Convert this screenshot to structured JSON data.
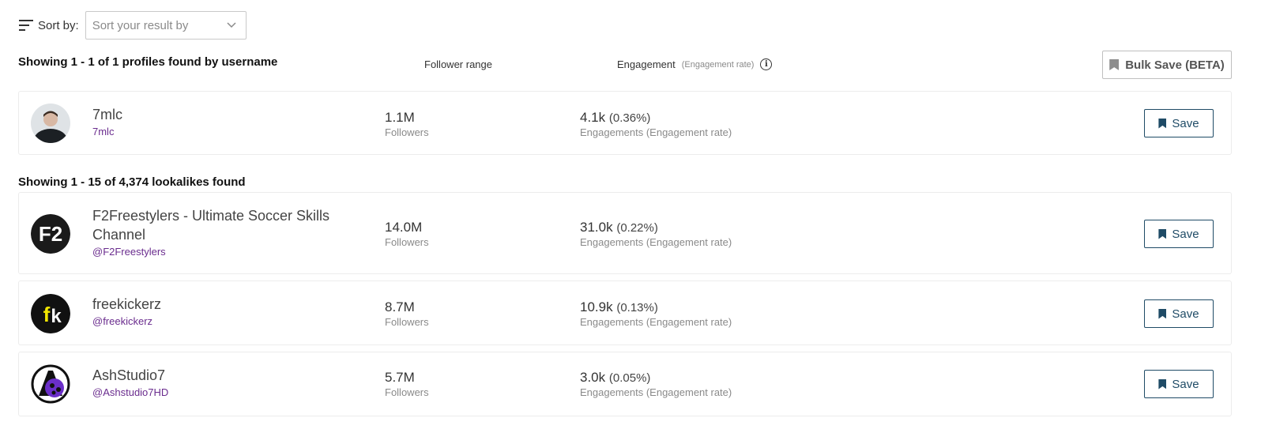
{
  "sort": {
    "label": "Sort by:",
    "placeholder": "Sort your result by"
  },
  "columns": {
    "follower": "Follower range",
    "engagement": "Engagement",
    "engagement_sub": "(Engagement rate)"
  },
  "username_results": {
    "showing": "Showing 1 - 1 of 1 profiles found by username",
    "bulk_save": "Bulk Save (BETA)",
    "profiles": [
      {
        "name": "7mlc",
        "handle": "7mlc",
        "followers": "1.1M",
        "followers_label": "Followers",
        "engagements": "4.1k",
        "rate": "(0.36%)",
        "engagement_label": "Engagements (Engagement rate)",
        "save": "Save"
      }
    ]
  },
  "lookalikes": {
    "showing": "Showing 1 - 15 of 4,374 lookalikes found",
    "profiles": [
      {
        "name": "F2Freestylers - Ultimate Soccer Skills Channel",
        "handle": "@F2Freestylers",
        "followers": "14.0M",
        "followers_label": "Followers",
        "engagements": "31.0k",
        "rate": "(0.22%)",
        "engagement_label": "Engagements (Engagement rate)",
        "save": "Save"
      },
      {
        "name": "freekickerz",
        "handle": "@freekickerz",
        "followers": "8.7M",
        "followers_label": "Followers",
        "engagements": "10.9k",
        "rate": "(0.13%)",
        "engagement_label": "Engagements (Engagement rate)",
        "save": "Save"
      },
      {
        "name": "AshStudio7",
        "handle": "@Ashstudio7HD",
        "followers": "5.7M",
        "followers_label": "Followers",
        "engagements": "3.0k",
        "rate": "(0.05%)",
        "engagement_label": "Engagements (Engagement rate)",
        "save": "Save"
      }
    ]
  },
  "icons": {
    "sort": "sort-lines-icon",
    "chevron": "chevron-down-icon",
    "info": "info-icon",
    "bookmark": "bookmark-icon"
  },
  "colors": {
    "handle": "#6a2c8e",
    "save_border": "#1f4b66"
  }
}
